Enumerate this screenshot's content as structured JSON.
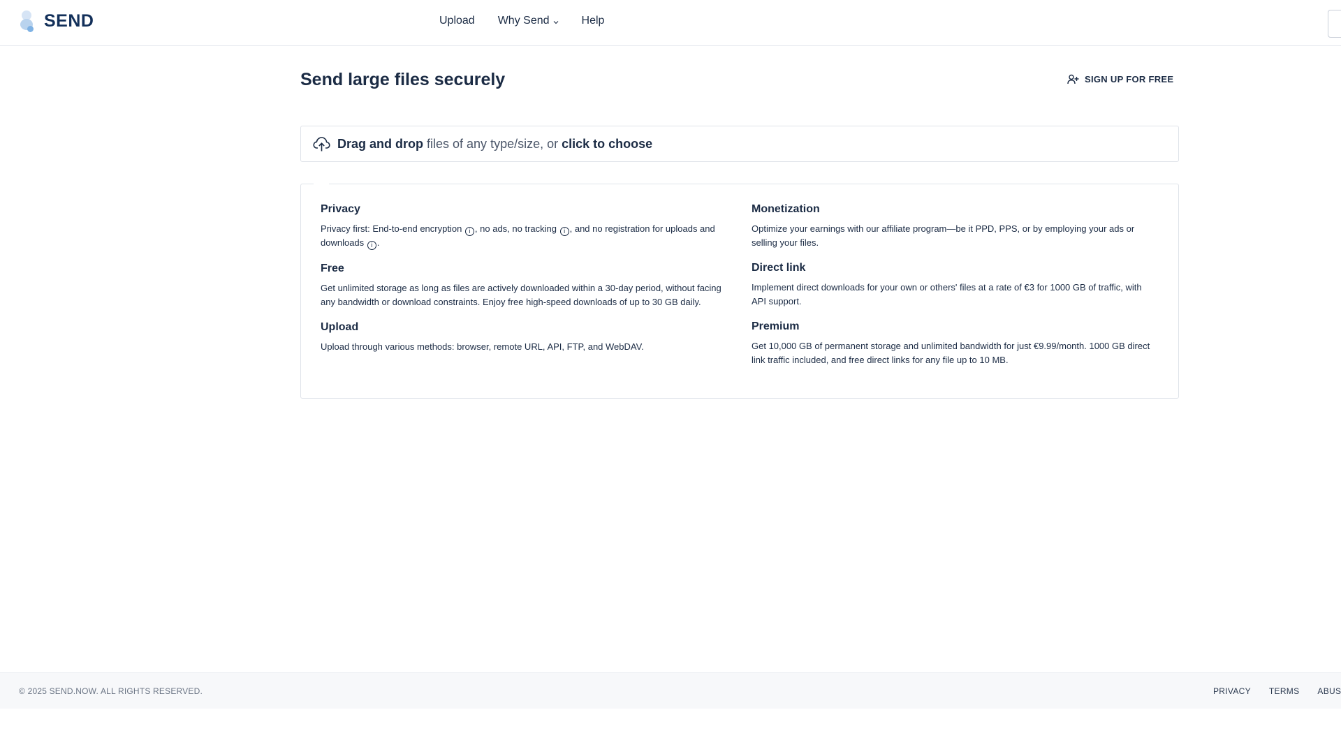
{
  "header": {
    "logo_text": "SEND",
    "nav": [
      "Upload",
      "Why Send",
      "Help"
    ]
  },
  "main": {
    "title_bold": "Send",
    "title_rest": " large files securely",
    "signup_label": "SIGN UP FOR FREE",
    "drop": {
      "bold1": "Drag and drop",
      "middle": " files of any type/size, or ",
      "bold2": "click to choose"
    }
  },
  "features": {
    "privacy": {
      "title": "Privacy",
      "p1": "Privacy first: End-to-end encryption ",
      "p2": ", no ads, no tracking ",
      "p3": ", and no registration for uploads and downloads ",
      "p4": "."
    },
    "free": {
      "title": "Free",
      "text": "Get unlimited storage as long as files are actively downloaded within a 30-day period, without facing any bandwidth or download constraints. Enjoy free high-speed downloads of up to 30 GB daily."
    },
    "upload": {
      "title": "Upload",
      "text": "Upload through various methods: browser, remote URL, API, FTP, and WebDAV."
    },
    "monetization": {
      "title": "Monetization",
      "text": "Optimize your earnings with our affiliate program—be it PPD, PPS, or by employing your ads or selling your files."
    },
    "direct_link": {
      "title": "Direct link",
      "text": "Implement direct downloads for your own or others' files at a rate of €3 for 1000 GB of traffic, with API support."
    },
    "premium": {
      "title": "Premium",
      "text": "Get 10,000 GB of permanent storage and unlimited bandwidth for just €9.99/month. 1000 GB direct link traffic included, and free direct links for any file up to 10 MB."
    }
  },
  "footer": {
    "copyright": "© 2025 SEND.NOW. ALL RIGHTS RESERVED.",
    "links": [
      "PRIVACY",
      "TERMS",
      "ABUSE"
    ]
  }
}
